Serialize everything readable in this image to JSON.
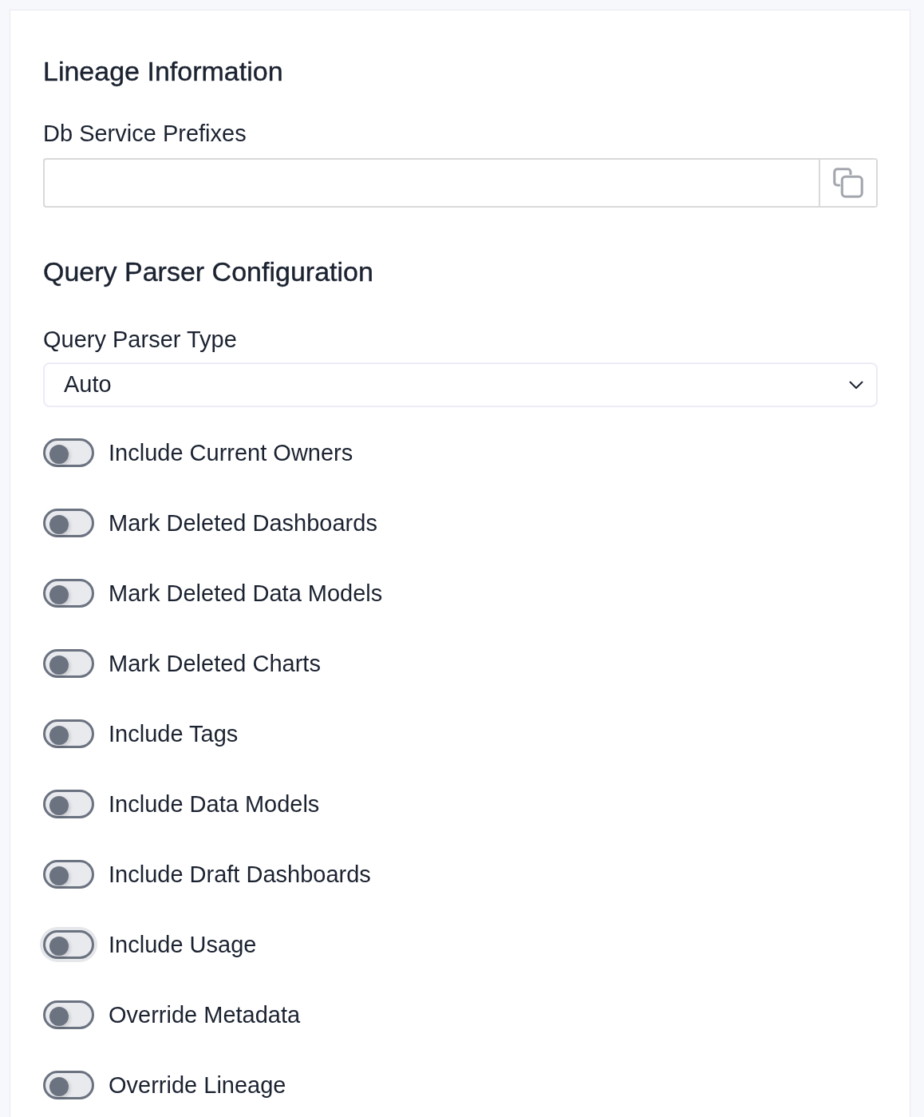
{
  "sections": [
    {
      "title": "Lineage Information",
      "fields": [
        {
          "kind": "text_copy",
          "label": "Db Service Prefixes"
        }
      ]
    },
    {
      "title": "Query Parser Configuration",
      "fields": [
        {
          "kind": "select",
          "label": "Query Parser Type",
          "value": "Auto"
        },
        {
          "kind": "toggle",
          "label": "Include Current Owners",
          "on": false,
          "focused": false
        },
        {
          "kind": "toggle",
          "label": "Mark Deleted Dashboards",
          "on": false,
          "focused": false
        },
        {
          "kind": "toggle",
          "label": "Mark Deleted Data Models",
          "on": false,
          "focused": false
        },
        {
          "kind": "toggle",
          "label": "Mark Deleted Charts",
          "on": false,
          "focused": false
        },
        {
          "kind": "toggle",
          "label": "Include Tags",
          "on": false,
          "focused": false
        },
        {
          "kind": "toggle",
          "label": "Include Data Models",
          "on": false,
          "focused": false
        },
        {
          "kind": "toggle",
          "label": "Include Draft Dashboards",
          "on": false,
          "focused": false
        },
        {
          "kind": "toggle",
          "label": "Include Usage",
          "on": false,
          "focused": true
        },
        {
          "kind": "toggle",
          "label": "Override Metadata",
          "on": false,
          "focused": false
        },
        {
          "kind": "toggle",
          "label": "Override Lineage",
          "on": false,
          "focused": false
        }
      ]
    }
  ]
}
